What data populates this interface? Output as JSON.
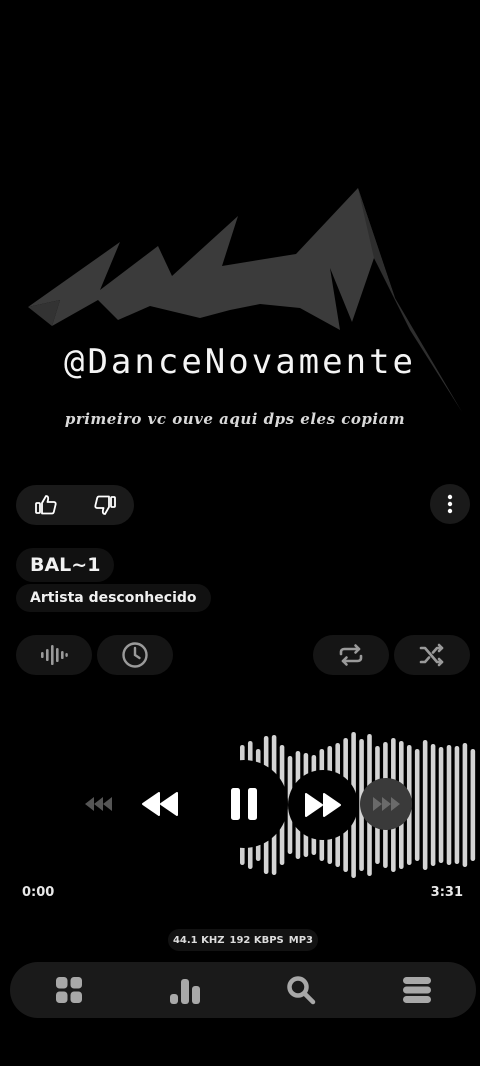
{
  "artwork": {
    "title": "@DanceNovamente",
    "subtitle": "primeiro vc ouve aqui dps eles copiam"
  },
  "actions": {
    "like_icon": "thumbs-up-icon",
    "dislike_icon": "thumbs-down-icon",
    "more_icon": "more-vertical-icon"
  },
  "track": {
    "title": "BAL~1",
    "artist": "Artista desconhecido"
  },
  "toolbar": {
    "equalizer_icon": "waveform-icon",
    "timer_icon": "clock-icon",
    "repeat_icon": "repeat-icon",
    "shuffle_icon": "shuffle-icon"
  },
  "playback": {
    "current_time": "0:00",
    "duration": "3:31",
    "progress": 0,
    "state": "playing"
  },
  "format": {
    "sample_rate": "44.1 KHZ",
    "bitrate": "192 KBPS",
    "codec": "MP3"
  },
  "nav": {
    "items": [
      "grid-icon",
      "bars-icon",
      "search-icon",
      "menu-icon"
    ]
  },
  "colors": {
    "background": "#000000",
    "surface": "#151515",
    "nav_surface": "#1a1a1a",
    "foreground": "#ffffff"
  }
}
